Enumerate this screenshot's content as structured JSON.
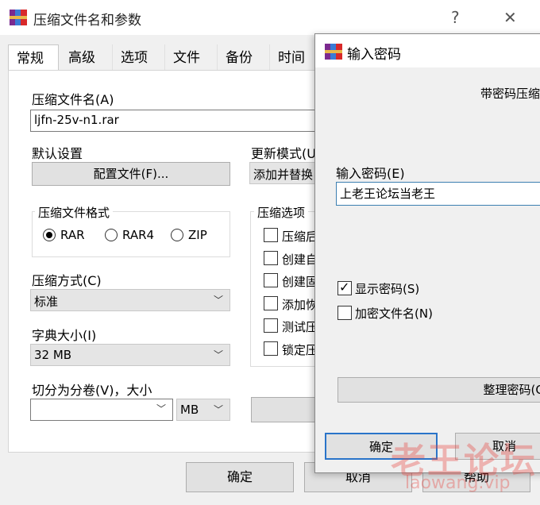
{
  "main_window": {
    "title": "压缩文件名和参数",
    "help_button": "?",
    "close_button": "✕",
    "tabs": [
      "常规",
      "高级",
      "选项",
      "文件",
      "备份",
      "时间"
    ],
    "archive_name_label": "压缩文件名(A)",
    "archive_name_value": "ljfn-25v-n1.rar",
    "default_settings_label": "默认设置",
    "profiles_button": "配置文件(F)...",
    "update_mode_label": "更新模式(U",
    "update_mode_value": "添加并替换",
    "format_group_title": "压缩文件格式",
    "formats": [
      "RAR",
      "RAR4",
      "ZIP"
    ],
    "selected_format": "RAR",
    "method_label": "压缩方式(C)",
    "method_value": "标准",
    "dict_label": "字典大小(I)",
    "dict_value": "32 MB",
    "split_label": "切分为分卷(V)，大小",
    "split_value": "",
    "split_unit": "MB",
    "options_group_title": "压缩选项",
    "options": [
      "压缩后",
      "创建自",
      "创建固",
      "添加恢",
      "测试压",
      "锁定压"
    ],
    "ok_button": "确定",
    "cancel_button": "取消",
    "help_bottom_button": "帮助"
  },
  "password_dialog": {
    "title": "输入密码",
    "header_text": "带密码压缩",
    "password_label": "输入密码(E)",
    "password_value": "上老王论坛当老王",
    "show_password_label": "显示密码(S)",
    "show_password_checked": true,
    "encrypt_names_label": "加密文件名(N)",
    "encrypt_names_checked": false,
    "organize_button": "整理密码(O)",
    "ok_button": "确定",
    "cancel_button": "取消"
  },
  "watermark": {
    "text": "老王论坛",
    "url": "laowang.vip"
  }
}
